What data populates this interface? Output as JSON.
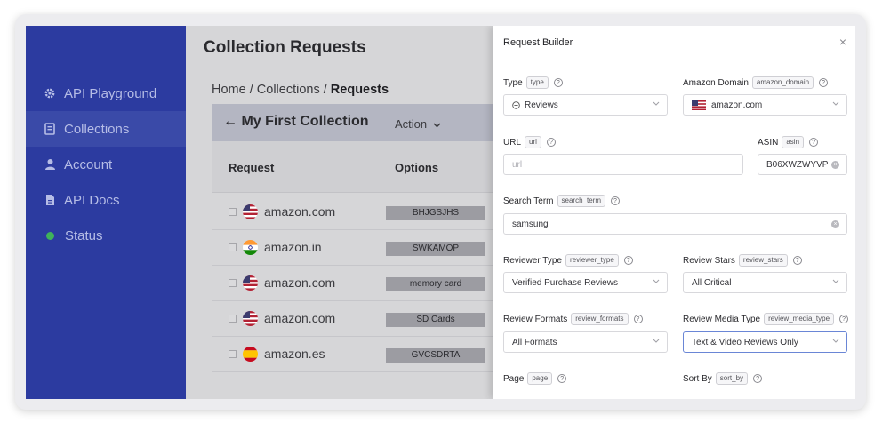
{
  "sidebar": {
    "items": [
      {
        "label": "API Playground",
        "icon": "gear-icon"
      },
      {
        "label": "Collections",
        "icon": "collections-icon"
      },
      {
        "label": "Account",
        "icon": "user-icon"
      },
      {
        "label": "API Docs",
        "icon": "document-icon"
      },
      {
        "label": "Status",
        "icon": "status-dot-icon"
      }
    ]
  },
  "main": {
    "title": "Collection Requests",
    "breadcrumb": {
      "home": "Home",
      "sep1": " / ",
      "collections": "Collections",
      "sep2": " / ",
      "current": "Requests"
    },
    "collection": {
      "back_arrow": "←",
      "name": "My First Collection",
      "action_label": "Action"
    },
    "table": {
      "headers": [
        "Request",
        "Options"
      ],
      "rows": [
        {
          "domain": "amazon.com",
          "flag": "us",
          "option": "BHJGSJHS"
        },
        {
          "domain": "amazon.in",
          "flag": "in",
          "option": "SWKAMOP"
        },
        {
          "domain": "amazon.com",
          "flag": "us",
          "option": "memory card"
        },
        {
          "domain": "amazon.com",
          "flag": "us",
          "option": "SD Cards"
        },
        {
          "domain": "amazon.es",
          "flag": "es",
          "option": "GVCSDRTA"
        }
      ]
    }
  },
  "modal": {
    "title": "Request Builder",
    "close": "×",
    "fields": {
      "type": {
        "label": "Type",
        "tag": "type",
        "value": "Reviews"
      },
      "amazon_domain": {
        "label": "Amazon Domain",
        "tag": "amazon_domain",
        "value": "amazon.com"
      },
      "url": {
        "label": "URL",
        "tag": "url",
        "placeholder": "url"
      },
      "asin": {
        "label": "ASIN",
        "tag": "asin",
        "value": "B06XWZWYVP"
      },
      "search_term": {
        "label": "Search Term",
        "tag": "search_term",
        "value": "samsung"
      },
      "reviewer_type": {
        "label": "Reviewer Type",
        "tag": "reviewer_type",
        "value": "Verified Purchase Reviews"
      },
      "review_stars": {
        "label": "Review Stars",
        "tag": "review_stars",
        "value": "All Critical"
      },
      "review_formats": {
        "label": "Review Formats",
        "tag": "review_formats",
        "value": "All Formats"
      },
      "review_media_type": {
        "label": "Review Media Type",
        "tag": "review_media_type",
        "value": "Text & Video Reviews Only"
      },
      "page": {
        "label": "Page",
        "tag": "page"
      },
      "sort_by": {
        "label": "Sort By",
        "tag": "sort_by"
      }
    },
    "help_glyph": "?"
  },
  "colors": {
    "sidebar": "#2c3ba0",
    "accent_focus": "#6a86d6",
    "status_green": "#3fb25a"
  }
}
